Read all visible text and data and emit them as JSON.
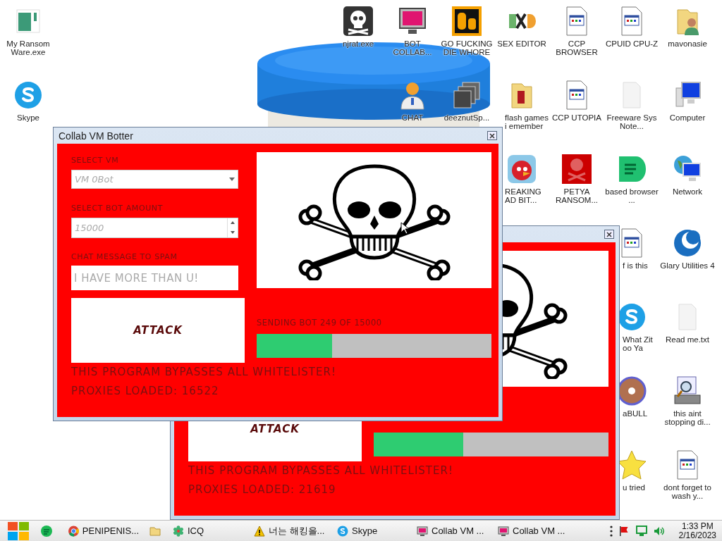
{
  "desktop": {
    "icon_columns": [
      {
        "icons": [
          {
            "kind": "ransom",
            "label": "My Ransom Ware.exe"
          },
          {
            "kind": "skype",
            "label": "Skype"
          }
        ]
      },
      {
        "icons": [
          {
            "kind": "skull",
            "label": "njrat.exe"
          }
        ]
      },
      {
        "icons": [
          {
            "kind": "monitor",
            "label": "BOT COLLAB..."
          },
          {
            "kind": "person",
            "label": "CHAT"
          }
        ]
      },
      {
        "icons": [
          {
            "kind": "de",
            "label": "GO FUCKING DIE WHORE"
          },
          {
            "kind": "stack",
            "label": "deeznutSp..."
          }
        ]
      },
      {
        "icons": [
          {
            "kind": "hxd",
            "label": "SEX EDITOR"
          },
          {
            "kind": "folder",
            "label": "flash games i emember"
          },
          {
            "kind": "bird",
            "label": "REAKING AD BIT..."
          }
        ]
      },
      {
        "icons": [
          {
            "kind": "doc",
            "label": "CCP BROWSER"
          },
          {
            "kind": "doc",
            "label": "CCP UTOPIA"
          },
          {
            "kind": "redskull",
            "label": "PETYA RANSOM..."
          }
        ]
      },
      {
        "icons": [
          {
            "kind": "doc",
            "label": "CPUID CPU-Z"
          },
          {
            "kind": "blank",
            "label": "Freeware Sys Note..."
          },
          {
            "kind": "chat",
            "label": "based browser ..."
          },
          {
            "kind": "doc",
            "label": "f is this"
          },
          {
            "kind": "skype",
            "label": "What Zit oo Ya"
          },
          {
            "kind": "disc",
            "label": "aBULL"
          },
          {
            "kind": "star",
            "label": "u tried"
          }
        ]
      },
      {
        "icons": [
          {
            "kind": "userfolder",
            "label": "mavonasie"
          },
          {
            "kind": "computer",
            "label": "Computer"
          },
          {
            "kind": "network",
            "label": "Network"
          },
          {
            "kind": "glary",
            "label": "Glary Utilities 4"
          },
          {
            "kind": "blank",
            "label": "Read me.txt"
          },
          {
            "kind": "drive",
            "label": "this aint stopping di..."
          },
          {
            "kind": "doc",
            "label": "dont forget to wash y..."
          }
        ]
      }
    ]
  },
  "windows": [
    {
      "title": "Collab VM Botter",
      "vm_label": "SELECT VM",
      "vm_value": "VM 0Bot",
      "amount_label": "SELECT BOT AMOUNT",
      "amount_value": "15000",
      "message_label": "CHAT MESSAGE TO SPAM",
      "message_value": "I HAVE MORE THAN U!",
      "attack_button": "ATTACK",
      "progress_label": "SENDING BOT 249 OF 15000",
      "progress": {
        "level": 0.32
      },
      "bypass_text": "THIS PROGRAM BYPASSES ALL WHITELISTER!",
      "proxies_text": "PROXIES LOADED: 16522"
    },
    {
      "attack_button": "ATTACK",
      "progress": {
        "level": 0.38
      },
      "bypass_text": "THIS PROGRAM BYPASSES ALL WHITELISTER!",
      "proxies_text": "PROXIES LOADED: 21619"
    }
  ],
  "taskbar": {
    "items": [
      {
        "kind": "spotify"
      },
      {
        "kind": "chrome",
        "label": "PENIPENIS..."
      },
      {
        "kind": "folder"
      },
      {
        "kind": "icq",
        "label": "ICQ"
      },
      {
        "kind": "warning",
        "label": "너는 해킹을..."
      },
      {
        "kind": "skype",
        "label": "Skype"
      },
      {
        "kind": "collab",
        "label": "Collab VM ..."
      },
      {
        "kind": "collab",
        "label": "Collab VM ..."
      }
    ],
    "time": "1:33 PM",
    "date": "2/16/2023"
  }
}
